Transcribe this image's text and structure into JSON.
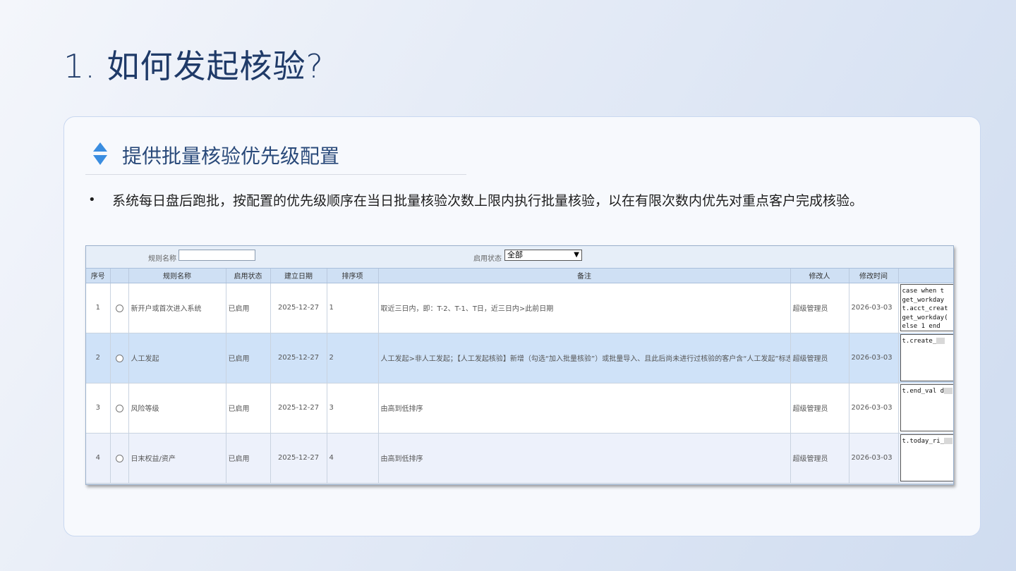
{
  "slide": {
    "title": "1. 如何发起核验?",
    "section_title": "提供批量核验优先级配置",
    "bullet": "系统每日盘后跑批，按配置的优先级顺序在当日批量核验次数上限内执行批量核验，以在有限次数内优先对重点客户完成核验。",
    "bullet_marker": "•"
  },
  "colors": {
    "title": "#1f3a68",
    "icon": "#3a8de0",
    "selected_row": "#cfe2f8"
  },
  "filter": {
    "name_label": "规则名称",
    "name_value": "",
    "status_label": "启用状态",
    "status_value": "全部"
  },
  "table": {
    "headers": [
      "序号",
      "",
      "规则名称",
      "启用状态",
      "建立日期",
      "排序项",
      "备注",
      "修改人",
      "修改时间",
      ""
    ],
    "rows": [
      {
        "no": "1",
        "name": "新开户或首次进入系统",
        "status": "已启用",
        "date": "2025-12-27",
        "order": "1",
        "remark": "取近三日内，即：T-2、T-1、T日，近三日内>此前日期",
        "modifier": "超级管理员",
        "modified": "2026-03-03",
        "code": [
          "case when t",
          "get_workday",
          "t.acct_creat",
          "get_workday(",
          "else 1 end"
        ]
      },
      {
        "no": "2",
        "name": "人工发起",
        "status": "已启用",
        "date": "2025-12-27",
        "order": "2",
        "remark": "人工发起>非人工发起；【人工发起核验】新增（勾选“加入批量核验”）或批量导入、且此后尚未进行过核验的客户含“人工发起”标志",
        "modifier": "超级管理员",
        "modified": "2026-03-03",
        "code": [
          "t.create_"
        ]
      },
      {
        "no": "3",
        "name": "风险等级",
        "status": "已启用",
        "date": "2025-12-27",
        "order": "3",
        "remark": "由高到低排序",
        "modifier": "超级管理员",
        "modified": "2026-03-03",
        "code": [
          "t.end_val d"
        ]
      },
      {
        "no": "4",
        "name": "日末权益/资产",
        "status": "已启用",
        "date": "2025-12-27",
        "order": "4",
        "remark": "由高到低排序",
        "modifier": "超级管理员",
        "modified": "2026-03-03",
        "code": [
          "t.today_ri_"
        ]
      }
    ]
  }
}
